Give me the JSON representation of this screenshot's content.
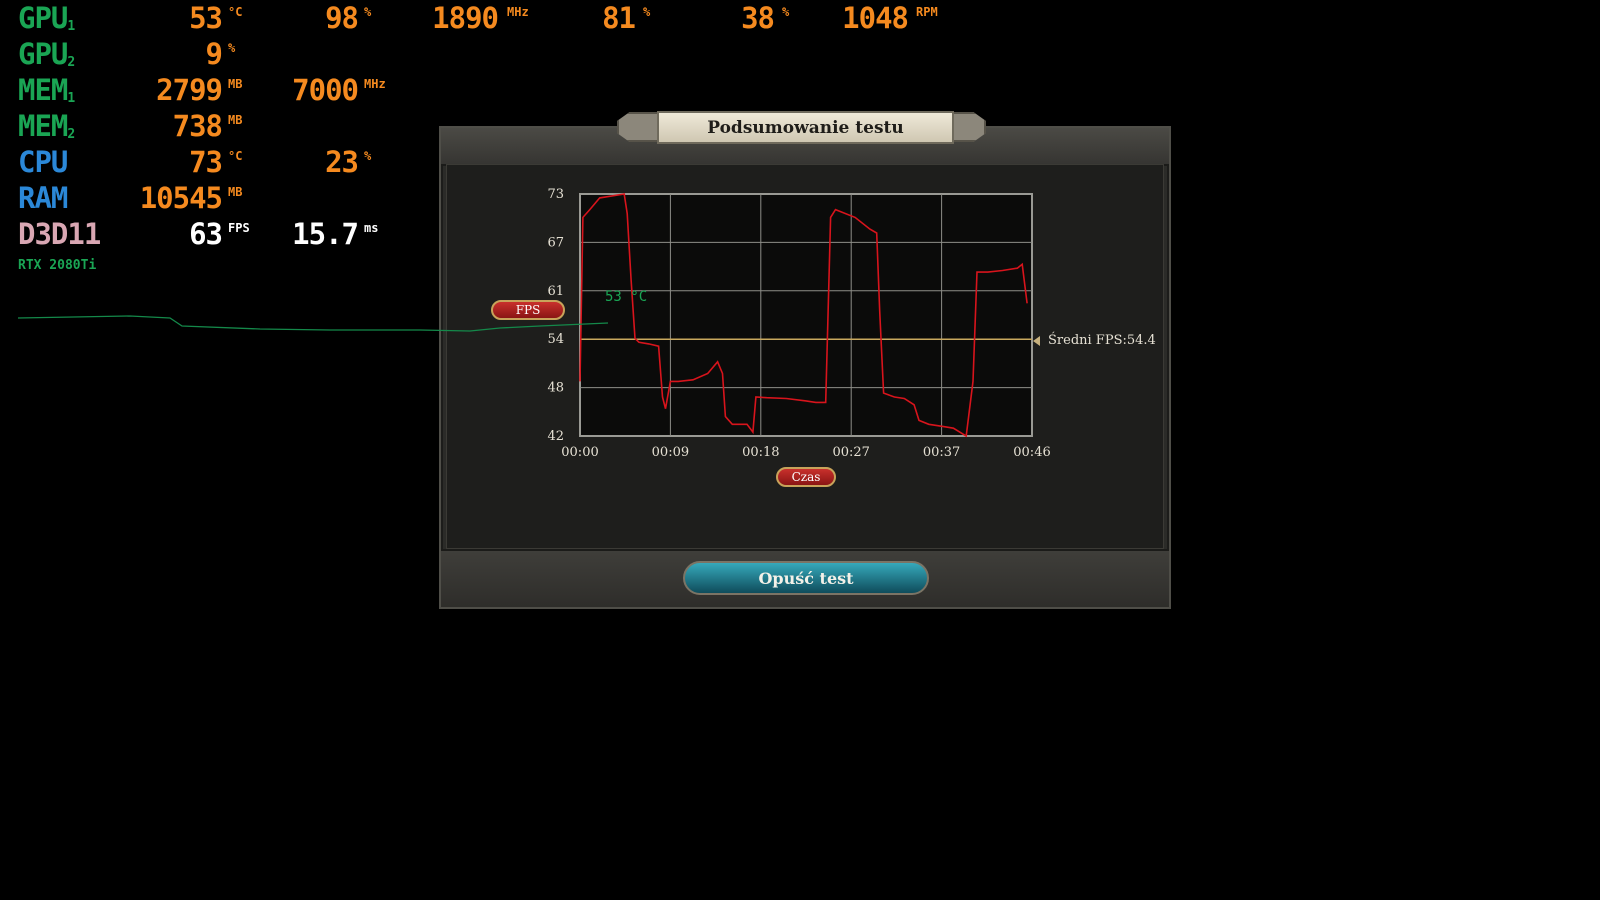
{
  "osd": {
    "rows": [
      {
        "label": "GPU",
        "sub": "1",
        "cells": [
          {
            "value": "53",
            "unit": "°C"
          },
          {
            "value": "98",
            "unit": "%"
          },
          {
            "value": "1890",
            "unit": "MHz"
          },
          {
            "value": "81",
            "unit": "%"
          },
          {
            "value": "38",
            "unit": "%"
          },
          {
            "value": "1048",
            "unit": "RPM"
          }
        ]
      },
      {
        "label": "GPU",
        "sub": "2",
        "cells": [
          {
            "value": "9",
            "unit": "%"
          }
        ]
      },
      {
        "label": "MEM",
        "sub": "1",
        "cells": [
          {
            "value": "2799",
            "unit": "MB"
          },
          {
            "value": "7000",
            "unit": "MHz"
          }
        ]
      },
      {
        "label": "MEM",
        "sub": "2",
        "cells": [
          {
            "value": "738",
            "unit": "MB"
          }
        ]
      },
      {
        "label": "CPU",
        "sub": "",
        "cells": [
          {
            "value": "73",
            "unit": "°C"
          },
          {
            "value": "23",
            "unit": "%"
          }
        ]
      },
      {
        "label": "RAM",
        "sub": "",
        "cells": [
          {
            "value": "10545",
            "unit": "MB"
          }
        ]
      },
      {
        "label": "D3D11",
        "sub": "",
        "cells": [
          {
            "value": "63",
            "unit": "FPS"
          },
          {
            "value": "15.7",
            "unit": "ms"
          }
        ]
      }
    ],
    "gpu_name": "RTX 2080Ti",
    "temp_graph_label": "53 °C",
    "colors": {
      "gpu": "#1aa554",
      "cpu": "#2b88d8",
      "api": "#d9a7b3",
      "value": "#f58a1f"
    }
  },
  "dialog": {
    "title": "Podsumowanie testu",
    "y_badge": "FPS",
    "x_badge": "Czas",
    "avg_label": "Średni FPS:54.4",
    "exit_button": "Opuść test"
  },
  "chart_data": {
    "type": "line",
    "ylim": [
      42,
      73
    ],
    "y_ticks": [
      "73",
      "67",
      "61",
      "54",
      "48",
      "42"
    ],
    "x_ticks": [
      "00:00",
      "00:09",
      "00:18",
      "00:27",
      "00:37",
      "00:46"
    ],
    "xlim": [
      0,
      46
    ],
    "average": 54.4,
    "series": [
      {
        "color": "#d8141c",
        "points": [
          [
            0,
            49
          ],
          [
            0.3,
            70
          ],
          [
            1,
            71
          ],
          [
            2,
            72.5
          ],
          [
            4.5,
            73
          ],
          [
            4.8,
            70.5
          ],
          [
            5.2,
            62
          ],
          [
            5.6,
            54.5
          ],
          [
            6,
            54
          ],
          [
            7,
            53.8
          ],
          [
            8,
            53.5
          ],
          [
            8.4,
            47
          ],
          [
            8.7,
            45.5
          ],
          [
            9.2,
            49
          ],
          [
            10,
            49
          ],
          [
            11.5,
            49.2
          ],
          [
            13,
            50
          ],
          [
            14,
            51.5
          ],
          [
            14.5,
            50
          ],
          [
            14.8,
            44.5
          ],
          [
            15.5,
            43.5
          ],
          [
            17,
            43.5
          ],
          [
            17.6,
            42.5
          ],
          [
            17.9,
            47
          ],
          [
            19,
            46.9
          ],
          [
            21,
            46.8
          ],
          [
            23,
            46.5
          ],
          [
            24,
            46.3
          ],
          [
            25,
            46.3
          ],
          [
            25.5,
            70
          ],
          [
            26,
            71
          ],
          [
            28,
            70
          ],
          [
            29.5,
            68.5
          ],
          [
            30.2,
            68
          ],
          [
            30.5,
            58
          ],
          [
            30.9,
            47.5
          ],
          [
            32,
            47
          ],
          [
            33,
            46.8
          ],
          [
            34,
            46
          ],
          [
            34.5,
            44
          ],
          [
            35.5,
            43.5
          ],
          [
            37,
            43.2
          ],
          [
            38,
            43
          ],
          [
            39.3,
            42
          ],
          [
            40,
            49
          ],
          [
            40.4,
            63
          ],
          [
            41.5,
            63
          ],
          [
            43,
            63.2
          ],
          [
            44.5,
            63.5
          ],
          [
            45,
            64
          ],
          [
            45.5,
            59
          ]
        ]
      }
    ]
  }
}
